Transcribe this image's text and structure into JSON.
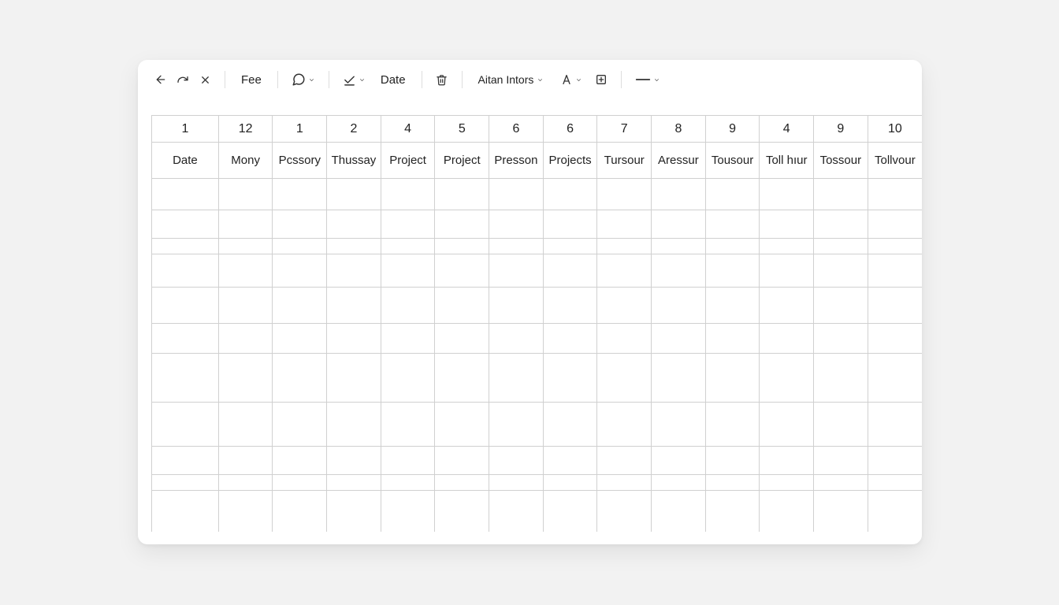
{
  "toolbar": {
    "fee_label": "Fee",
    "date_label": "Date",
    "font_label": "Aitan Intors"
  },
  "column_numbers": [
    "1",
    "12",
    "1",
    "2",
    "4",
    "5",
    "6",
    "6",
    "7",
    "8",
    "9",
    "4",
    "9",
    "10"
  ],
  "column_headers": [
    "Date",
    "Mony",
    "Pcssory",
    "Thussay",
    "Project",
    "Project",
    "Presson",
    "Projects",
    "Tursour",
    "Aressur",
    "Tousour",
    "Toll hıur",
    "Tossour",
    "Tollvour"
  ],
  "row_count": 11
}
